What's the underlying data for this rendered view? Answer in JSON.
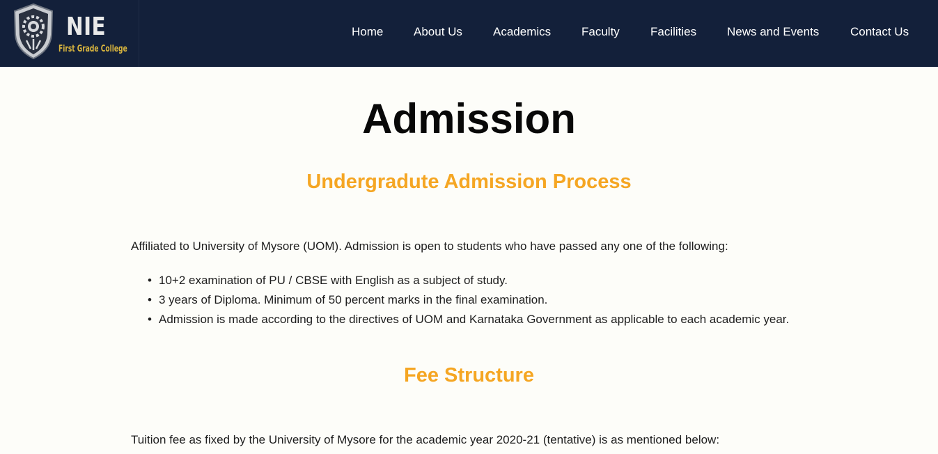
{
  "header": {
    "logo": {
      "title": "NIE",
      "subtitle": "First Grade College",
      "emblem": "shield-gear-emblem"
    },
    "nav": [
      {
        "label": "Home"
      },
      {
        "label": "About Us"
      },
      {
        "label": "Academics"
      },
      {
        "label": "Faculty"
      },
      {
        "label": "Facilities"
      },
      {
        "label": "News and Events"
      },
      {
        "label": "Contact Us"
      }
    ]
  },
  "main": {
    "title": "Admission",
    "admission_section": {
      "heading": "Undergradute Admission Process",
      "intro": "Affiliated to University of Mysore (UOM). Admission is open to students who have passed any one of the following:",
      "requirements": [
        "10+2 examination of PU / CBSE with English as a subject of study.",
        "3 years of Diploma. Minimum of 50 percent marks in the final examination.",
        "Admission is made according to the directives of UOM and Karnataka Government as applicable to each academic year."
      ]
    },
    "fee_section": {
      "heading": "Fee Structure",
      "intro": "Tuition fee as fixed by the University of Mysore for the academic year 2020-21 (tentative) is as mentioned below:"
    }
  },
  "colors": {
    "navbar_bg": "#13203a",
    "accent_heading": "#f5a623",
    "page_bg": "#fdfdf9",
    "logo_subtitle": "#d9b53e"
  }
}
